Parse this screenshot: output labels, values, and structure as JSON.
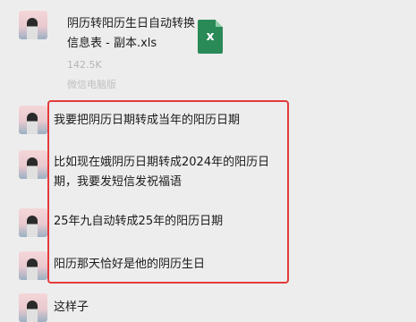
{
  "file_message": {
    "file_name": "阴历转阳历生日自动转换信息表 - 副本.xls",
    "file_size": "142.5K",
    "source_label": "微信电脑版",
    "file_icon_letter": "x",
    "file_icon_color": "#2a8a57"
  },
  "messages": [
    {
      "text": "我要把阴历日期转成当年的阳历日期"
    },
    {
      "text": "比如现在娥阴历日期转成2024年的阳历日期，我要发短信发祝福语"
    },
    {
      "text": "25年九自动转成25年的阳历日期"
    },
    {
      "text": "阳历那天恰好是他的阴历生日"
    },
    {
      "text": "这样子"
    }
  ],
  "highlight_color": "#e23b3b"
}
